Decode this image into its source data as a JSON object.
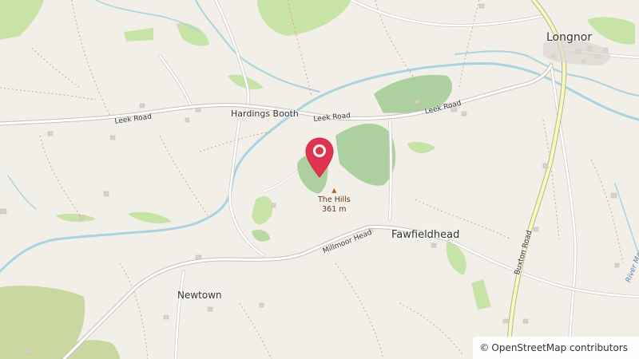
{
  "map": {
    "places": {
      "longnor": "Longnor",
      "hardings_booth": "Hardings Booth",
      "fawfieldhead": "Fawfieldhead",
      "newtown": "Newtown"
    },
    "roads": {
      "leek_road_west": "Leek Road",
      "leek_road_mid": "Leek Road",
      "leek_road_east": "Leek Road",
      "millmoor_head": "Millmoor Head",
      "buxton_road": "Buxton Road"
    },
    "peak": {
      "name": "The Hills",
      "elevation": "361 m"
    },
    "river": "River Manifold",
    "marker_icon": "map-pin-icon",
    "colors": {
      "background": "#f2efe9",
      "woodland": "#add19e",
      "grass": "#c8e3a6",
      "water": "#aad3df",
      "main_road": "#f7fabf",
      "marker": "#e0334f"
    }
  },
  "attribution": {
    "symbol": "©",
    "text": "OpenStreetMap contributors"
  }
}
